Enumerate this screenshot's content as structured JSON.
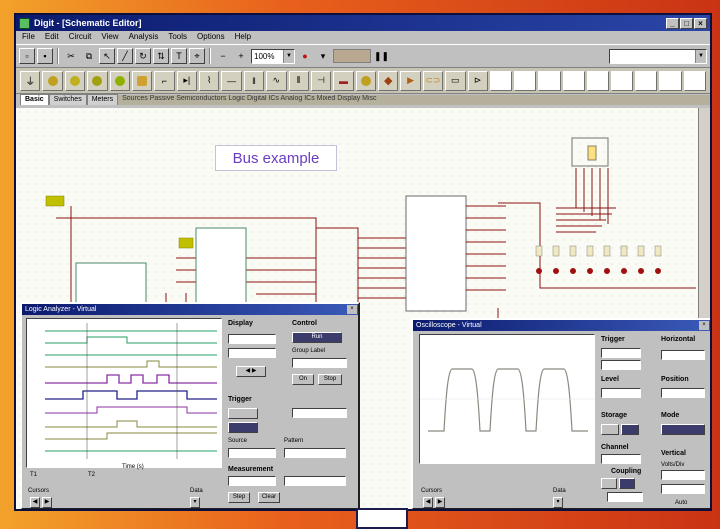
{
  "window": {
    "title": "Digit - [Schematic Editor]"
  },
  "menu": [
    "File",
    "Edit",
    "Circuit",
    "View",
    "Analysis",
    "Tools",
    "Options",
    "Help"
  ],
  "toolbar": {
    "zoom": "100%",
    "component_search": ""
  },
  "tabs": [
    "Basic",
    "Switches",
    "Meters"
  ],
  "tab_extra": "Sources  Passive  Semiconductors  Logic  Digital ICs  Analog ICs  Mixed  Display  Misc",
  "schematic": {
    "annotation": "Bus example"
  },
  "logic_analyzer": {
    "title": "Logic Analyzer - Virtual",
    "cursor_t1": "T1",
    "cursor_t2": "T2",
    "time_readout": "Time (s)",
    "groups": {
      "display": "Display",
      "control": "Control",
      "trigger": "Trigger",
      "measurement": "Measurement"
    },
    "labels": {
      "group_label": "Group Label",
      "source": "Source",
      "pattern": "Pattern",
      "cursors": "Cursors",
      "data": "Data"
    },
    "buttons": {
      "on": "On",
      "run": "Run",
      "stop": "Stop",
      "single": "Step",
      "clear": "Clear"
    }
  },
  "oscilloscope": {
    "title": "Oscilloscope - Virtual",
    "groups": {
      "trigger": "Trigger",
      "horizontal": "Horizontal",
      "level": "Level",
      "position": "Position",
      "storage": "Storage",
      "mode": "Mode",
      "channel": "Channel",
      "coupling": "Coupling",
      "vertical": "Vertical",
      "volts_div": "Volts/Div",
      "cursors": "Cursors",
      "data": "Data",
      "auto": "Auto"
    }
  },
  "colors": {
    "wire": "#8a1010",
    "bus": "#555555",
    "trace_blue": "#20208a",
    "trace_purple": "#8a30a0",
    "trace_olive": "#8a8a40",
    "trace_green": "#20a060",
    "title_blue": "#0b1a6e"
  }
}
